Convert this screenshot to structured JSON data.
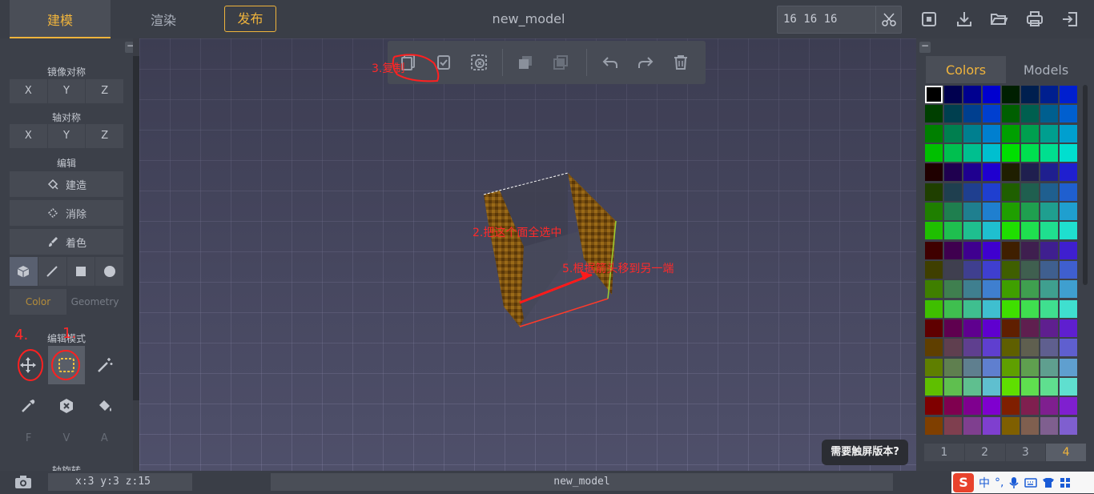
{
  "header": {
    "tab_model": "建模",
    "tab_render": "渲染",
    "publish": "发布",
    "file_name": "new_model",
    "size_value": "16 16 16"
  },
  "left_panel": {
    "mirror_title": "镜像对称",
    "mirror_axes": [
      "X",
      "Y",
      "Z"
    ],
    "axis_title": "轴对称",
    "axis_axes": [
      "X",
      "Y",
      "Z"
    ],
    "edit_title": "编辑",
    "build": "建造",
    "erase": "消除",
    "paint": "着色",
    "color_tab": "Color",
    "geometry_tab": "Geometry",
    "edit_mode_title": "编辑模式",
    "fva": [
      "F",
      "V",
      "A"
    ],
    "rotate_title": "轴旋转"
  },
  "annotations": {
    "copy": "3.复制",
    "select_face": "2.把这个面全选中",
    "move": "5.根据箭头移到另一端",
    "step1": "1.",
    "step4": "4."
  },
  "touch_tip": "需要触屏版本?",
  "right_panel": {
    "tab_colors": "Colors",
    "tab_models": "Models",
    "pages": [
      "1",
      "2",
      "3",
      "4"
    ],
    "active_page": "4"
  },
  "status": {
    "coords": "x:3  y:3  z:15",
    "file_name": "new_model"
  },
  "ime": {
    "logo": "S",
    "lang": "中",
    "punct": "°,"
  },
  "colors": {
    "accent": "#f0b43c",
    "annotation": "#ff2a2a",
    "palette": [
      "#000000",
      "#00004f",
      "#00008f",
      "#0000cf",
      "#001f00",
      "#001f4f",
      "#001f8f",
      "#001fcf",
      "#003f00",
      "#003f4f",
      "#003f8f",
      "#003fcf",
      "#005f00",
      "#005f4f",
      "#005f8f",
      "#005fcf",
      "#007f00",
      "#007f4f",
      "#007f8f",
      "#007fcf",
      "#009f00",
      "#009f4f",
      "#009f8f",
      "#009fcf",
      "#00bf00",
      "#00bf4f",
      "#00bf8f",
      "#00bfcf",
      "#00df00",
      "#00df4f",
      "#00df8f",
      "#00dfcf",
      "#1f0000",
      "#1f004f",
      "#1f008f",
      "#1f00cf",
      "#1f1f00",
      "#1f1f4f",
      "#1f1f8f",
      "#1f1fcf",
      "#1f3f00",
      "#1f3f4f",
      "#1f3f8f",
      "#1f3fcf",
      "#1f5f00",
      "#1f5f4f",
      "#1f5f8f",
      "#1f5fcf",
      "#1f7f00",
      "#1f7f4f",
      "#1f7f8f",
      "#1f7fcf",
      "#1f9f00",
      "#1f9f4f",
      "#1f9f8f",
      "#1f9fcf",
      "#1fbf00",
      "#1fbf4f",
      "#1fbf8f",
      "#1fbfcf",
      "#1fdf00",
      "#1fdf4f",
      "#1fdf8f",
      "#1fdfcf",
      "#3f0000",
      "#3f004f",
      "#3f008f",
      "#3f00cf",
      "#3f1f00",
      "#3f1f4f",
      "#3f1f8f",
      "#3f1fcf",
      "#3f3f00",
      "#3f3f4f",
      "#3f3f8f",
      "#3f3fcf",
      "#3f5f00",
      "#3f5f4f",
      "#3f5f8f",
      "#3f5fcf",
      "#3f7f00",
      "#3f7f4f",
      "#3f7f8f",
      "#3f7fcf",
      "#3f9f00",
      "#3f9f4f",
      "#3f9f8f",
      "#3f9fcf",
      "#3fbf00",
      "#3fbf4f",
      "#3fbf8f",
      "#3fbfcf",
      "#3fdf00",
      "#3fdf4f",
      "#3fdf8f",
      "#3fdfcf",
      "#5f0000",
      "#5f004f",
      "#5f008f",
      "#5f00cf",
      "#5f1f00",
      "#5f1f4f",
      "#5f1f8f",
      "#5f1fcf",
      "#5f3f00",
      "#5f3f4f",
      "#5f3f8f",
      "#5f3fcf",
      "#5f5f00",
      "#5f5f4f",
      "#5f5f8f",
      "#5f5fcf",
      "#5f7f00",
      "#5f7f4f",
      "#5f7f8f",
      "#5f7fcf",
      "#5f9f00",
      "#5f9f4f",
      "#5f9f8f",
      "#5f9fcf",
      "#5fbf00",
      "#5fbf4f",
      "#5fbf8f",
      "#5fbfcf",
      "#5fdf00",
      "#5fdf4f",
      "#5fdf8f",
      "#5fdfcf",
      "#7f0000",
      "#7f004f",
      "#7f008f",
      "#7f00cf",
      "#7f1f00",
      "#7f1f4f",
      "#7f1f8f",
      "#7f1fcf",
      "#7f3f00",
      "#7f3f4f",
      "#7f3f8f",
      "#7f3fcf",
      "#7f5f00",
      "#7f5f4f",
      "#7f5f8f",
      "#7f5fcf"
    ]
  }
}
